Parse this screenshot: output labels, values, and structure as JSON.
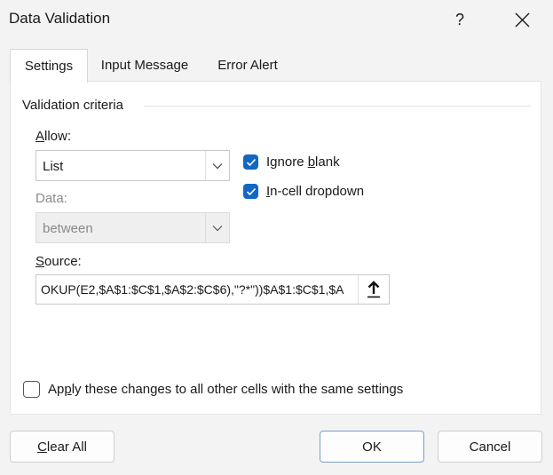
{
  "window": {
    "title": "Data Validation",
    "help": "?"
  },
  "tabs": [
    {
      "label": "Settings",
      "active": true
    },
    {
      "label": "Input Message",
      "active": false
    },
    {
      "label": "Error Alert",
      "active": false
    }
  ],
  "criteria": {
    "group_title": "Validation criteria",
    "allow_label": "Allow:",
    "allow_value": "List",
    "data_label": "Data:",
    "data_value": "between",
    "ignore_blank": {
      "label": "Ignore blank",
      "checked": true
    },
    "in_cell_dropdown": {
      "label": "In-cell dropdown",
      "checked": true
    },
    "source_label": "Source:",
    "source_value": "OKUP(E2,$A$1:$C$1,$A$2:$C$6),\"?*\"))$A$1:$C$1,$A"
  },
  "apply_all": {
    "label": "Apply these changes to all other cells with the same settings",
    "checked": false
  },
  "buttons": {
    "clear_all": "Clear All",
    "ok": "OK",
    "cancel": "Cancel"
  },
  "colors": {
    "accent": "#1366c2",
    "background": "#f3f3f3"
  },
  "icons": {
    "close": "close-icon",
    "dropdown": "chevron-down-icon",
    "collapse": "collapse-dialog-icon",
    "check": "checkmark-icon"
  }
}
